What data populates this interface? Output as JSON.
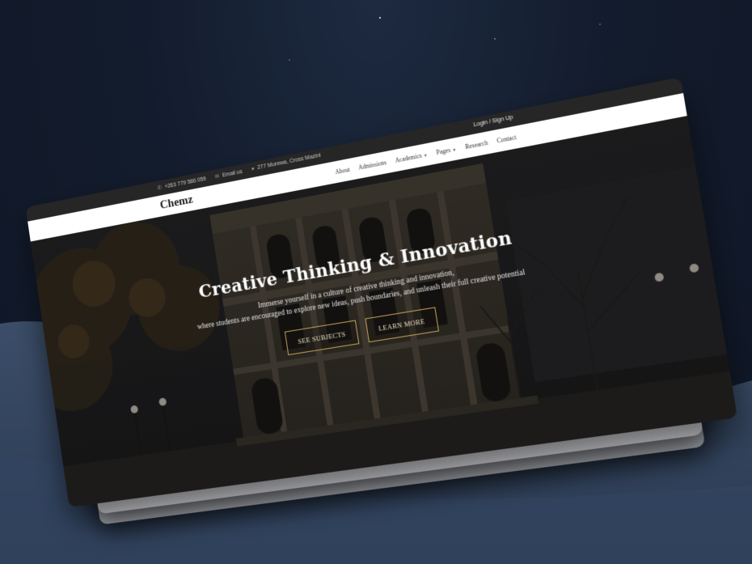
{
  "topbar": {
    "phone": "+263 779 586 059",
    "email": "Email us",
    "address": "277 Murewa, Cross Mazini",
    "login": "Login / Sign Up"
  },
  "navbar": {
    "brand": "Chemz",
    "links": [
      {
        "label": "About",
        "dropdown": false
      },
      {
        "label": "Admissions",
        "dropdown": false
      },
      {
        "label": "Academics",
        "dropdown": true
      },
      {
        "label": "Pages",
        "dropdown": true
      },
      {
        "label": "Research",
        "dropdown": false
      },
      {
        "label": "Contact",
        "dropdown": false
      }
    ]
  },
  "hero": {
    "title": "Creative Thinking & Innovation",
    "subtitle_line1": "Immerse yourself in a culture of creative thinking and innovation,",
    "subtitle_line2": "where students are encouraged to explore new ideas, push boundaries, and unleash their full creative potential",
    "buttons": {
      "primary": "SEE SUBJECTS",
      "secondary": "LEARN MORE"
    }
  },
  "icons": {
    "phone": "phone-icon",
    "email": "envelope-icon",
    "address": "map-pin-icon",
    "dropdown": "caret-down-icon"
  },
  "colors": {
    "topbar": "#262626",
    "navbar": "#ffffff",
    "accent_gold": "#c4a258",
    "backdrop": "#131c2d"
  }
}
